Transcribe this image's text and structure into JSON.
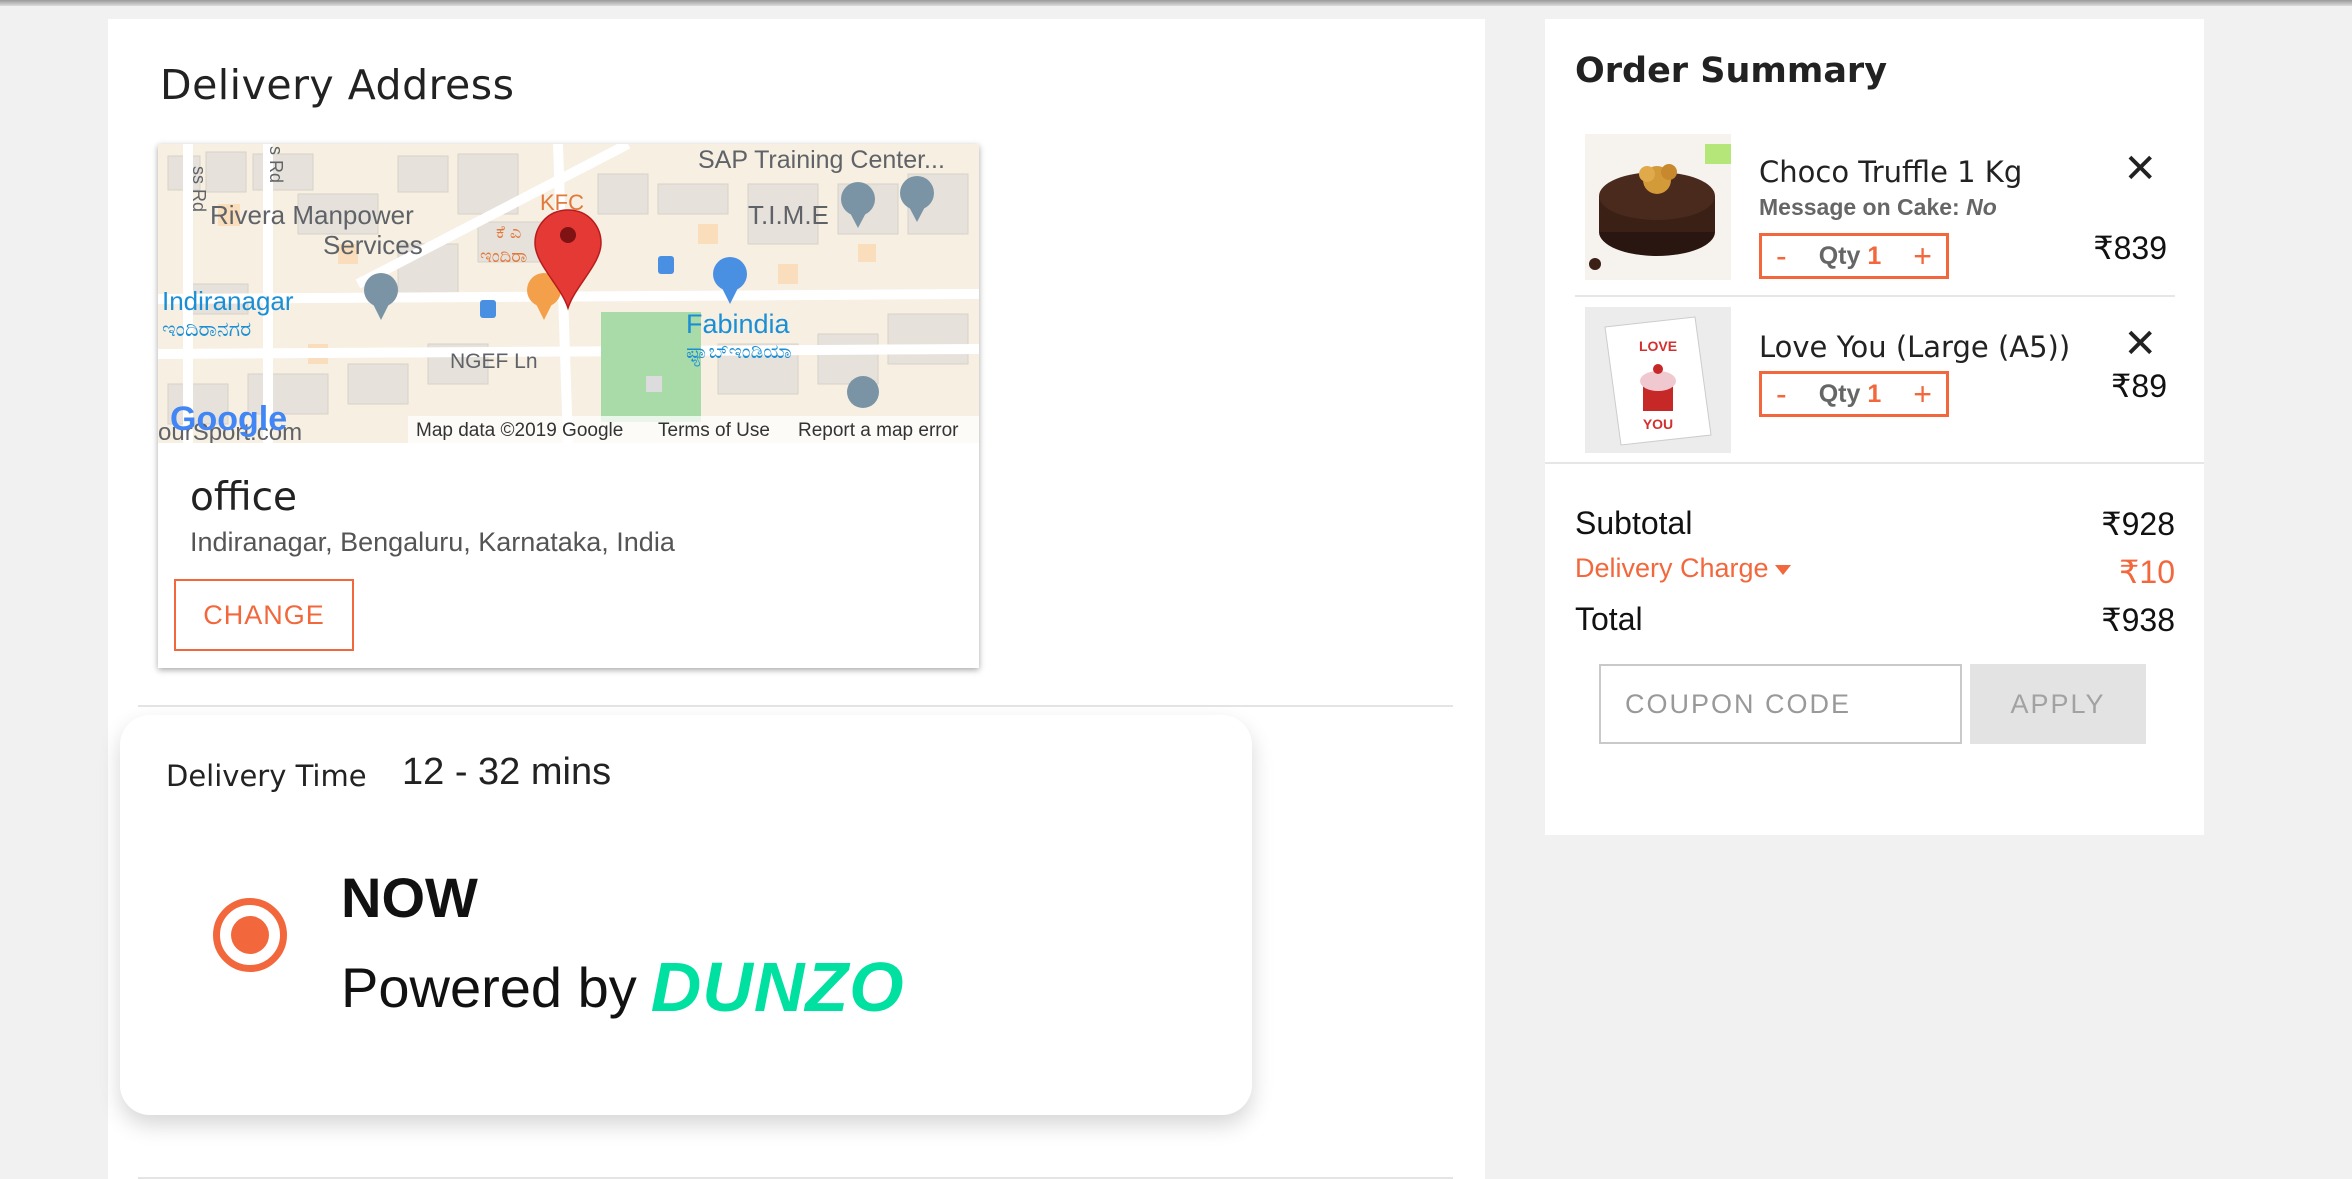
{
  "delivery_address": {
    "title": "Delivery Address",
    "map": {
      "labels": {
        "sap": "SAP Training Center...",
        "rivera": "Rivera Manpower",
        "rivera2": "Services",
        "time": "T.I.M.E",
        "indiranagar": "Indiranagar",
        "indiranagar_kn": "ಇಂದಿರಾನಗರ",
        "fabindia": "Fabindia",
        "fabindia_kn": "ಫ್ಯಾಬ್‌ಇಂಡಿಯಾ",
        "ngef": "NGEF Ln",
        "kfc": "KFC",
        "kfc_kn": "ಕೆ ಎ",
        "kfc_kn2": "ಇಂದಿರಾ",
        "ss_rd": "ss Rd",
        "s_rd": "s Rd",
        "sportscom": "ourSport.com"
      },
      "google_logo": "Google",
      "attribution": "Map data ©2019 Google",
      "terms": "Terms of Use",
      "report": "Report a map error"
    },
    "name": "office",
    "address_line": "Indiranagar, Bengaluru, Karnataka, India",
    "change_label": "CHANGE"
  },
  "delivery_time": {
    "label": "Delivery Time",
    "value": "12 - 32 mins",
    "option_title": "NOW",
    "powered_by": "Powered by",
    "brand": "DUNZO"
  },
  "order_summary": {
    "title": "Order Summary",
    "items": [
      {
        "name": "Choco Truffle 1 Kg",
        "message_label": "Message on Cake:",
        "message_value": "No",
        "qty_label": "Qty",
        "qty": "1",
        "minus": "-",
        "plus": "+",
        "price": "₹839",
        "remove": "✕"
      },
      {
        "name": "Love You (Large (A5))",
        "qty_label": "Qty",
        "qty": "1",
        "minus": "-",
        "plus": "+",
        "price": "₹89",
        "remove": "✕",
        "card_text_top": "LOVE",
        "card_text_bottom": "YOU"
      }
    ],
    "subtotal_label": "Subtotal",
    "subtotal_value": "₹928",
    "delivery_label": "Delivery Charge",
    "delivery_value": "₹10",
    "total_label": "Total",
    "total_value": "₹938",
    "coupon_placeholder": "COUPON CODE",
    "apply_label": "APPLY"
  },
  "colors": {
    "accent": "#f2683c",
    "dunzo": "#00e0a0"
  }
}
